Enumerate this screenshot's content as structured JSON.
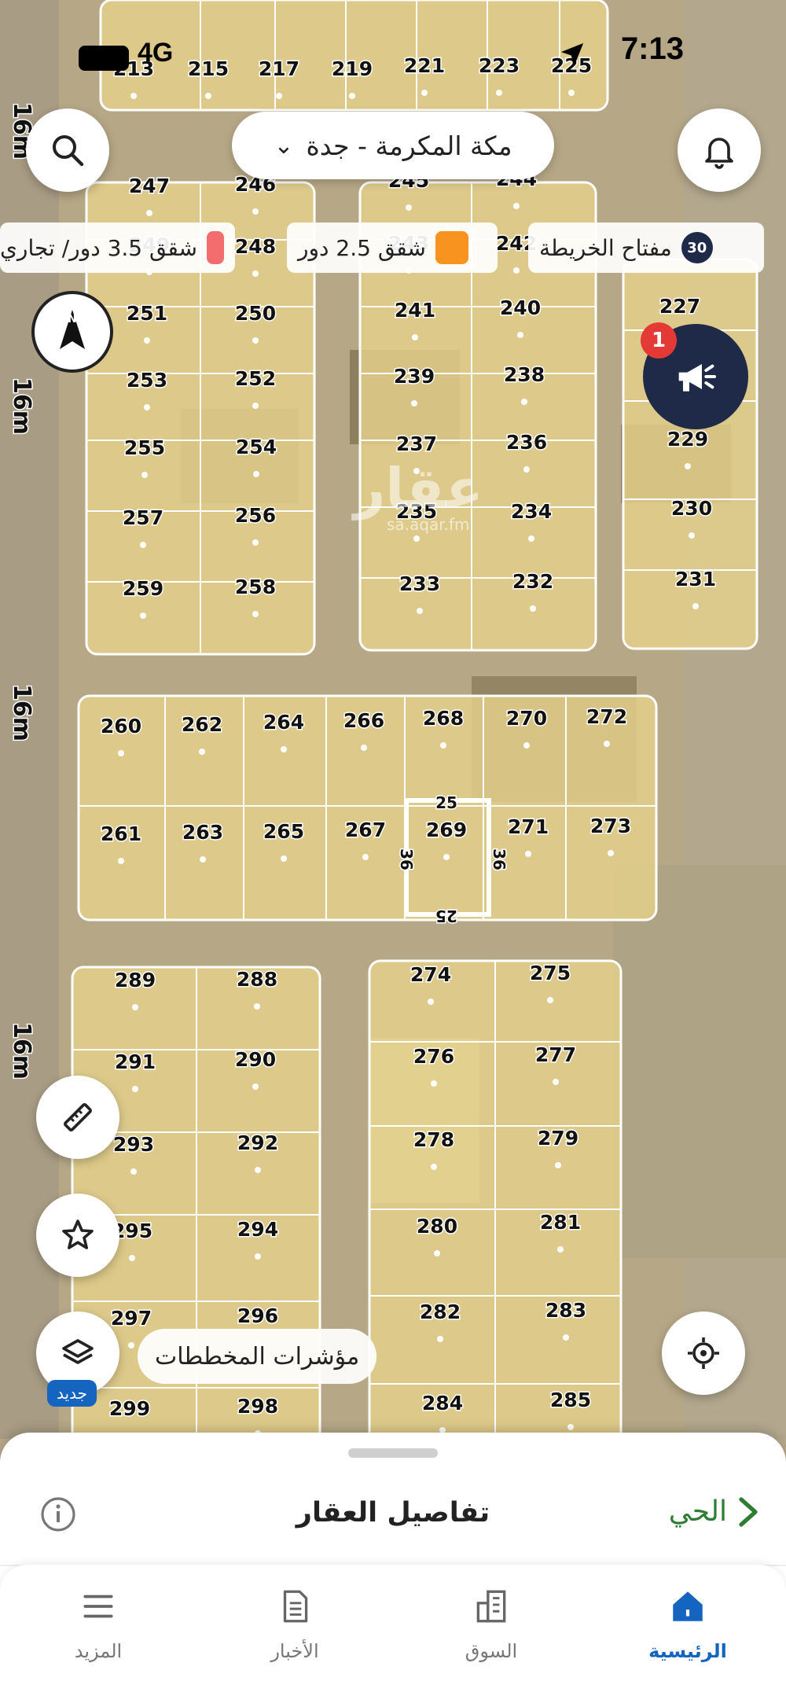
{
  "status_bar": {
    "time": "7:13",
    "network": "4G"
  },
  "header": {
    "city": "مكة المكرمة - جدة"
  },
  "legend": {
    "map_key_label": "مفتاح الخريطة",
    "map_key_count": "30",
    "items": [
      {
        "label": "شقق 2.5 دور",
        "color": "#f7931e"
      },
      {
        "label": "شقق 3.5 دور/ تجاري",
        "color": "#f26d6d"
      }
    ]
  },
  "notification_badge": "1",
  "watermark": {
    "brand": "عقار",
    "site": "sa.aqar.fm"
  },
  "map": {
    "road_labels": [
      "16m",
      "16m",
      "16m",
      "16m"
    ],
    "plot_dimensions": {
      "top": "25",
      "bottom": "25",
      "left": "36",
      "right": "36"
    },
    "plots": [
      "213",
      "215",
      "217",
      "219",
      "221",
      "223",
      "225",
      "247",
      "246",
      "245",
      "244",
      "249",
      "248",
      "243",
      "242",
      "227",
      "251",
      "250",
      "241",
      "240",
      "253",
      "252",
      "239",
      "238",
      "255",
      "254",
      "237",
      "236",
      "229",
      "257",
      "256",
      "235",
      "234",
      "230",
      "259",
      "258",
      "233",
      "232",
      "231",
      "260",
      "262",
      "264",
      "266",
      "268",
      "270",
      "272",
      "261",
      "263",
      "265",
      "267",
      "269",
      "271",
      "273",
      "289",
      "288",
      "274",
      "275",
      "291",
      "290",
      "276",
      "277",
      "293",
      "292",
      "278",
      "279",
      "295",
      "294",
      "280",
      "281",
      "297",
      "296",
      "282",
      "283",
      "299",
      "298",
      "284",
      "285"
    ]
  },
  "map_controls": {
    "indicators_label": "مؤشرات المخططات",
    "new_badge": "جديد"
  },
  "bottom_sheet": {
    "title": "تفاصيل العقار",
    "neighborhood_link": "الحي"
  },
  "tabs": [
    {
      "label": "الرئيسية",
      "icon": "home-icon",
      "active": true
    },
    {
      "label": "السوق",
      "icon": "buildings-icon",
      "active": false
    },
    {
      "label": "الأخبار",
      "icon": "news-icon",
      "active": false
    },
    {
      "label": "المزيد",
      "icon": "menu-icon",
      "active": false
    }
  ],
  "colors": {
    "plot_fill": "#e5d28b",
    "accent_blue": "#1565c0",
    "accent_green": "#2e7d32",
    "navy": "#1e2a48"
  }
}
